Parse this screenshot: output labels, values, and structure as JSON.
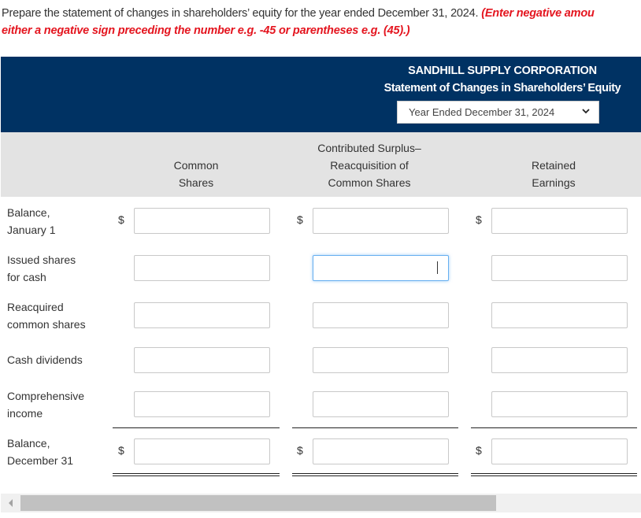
{
  "instructions": {
    "text": "Prepare the statement of changes in shareholders’ equity for the year ended December 31, 2024.",
    "note_line1": "(Enter negative amou",
    "note_line2": "either a negative sign preceding the number e.g. -45 or parentheses e.g. (45).)"
  },
  "header": {
    "company": "SANDHILL SUPPLY CORPORATION",
    "statement": "Statement of Changes in Shareholders’ Equity",
    "period_select": {
      "selected": "Year Ended December 31, 2024",
      "icon": "chevron-down-icon"
    }
  },
  "columns": [
    {
      "line1": "",
      "line2": "Common",
      "line3": "Shares"
    },
    {
      "line1": "Contributed Surplus–",
      "line2": "Reacquisition of",
      "line3": "Common Shares"
    },
    {
      "line1": "",
      "line2": "Retained",
      "line3": "Earnings"
    }
  ],
  "rows": [
    {
      "label1": "Balance,",
      "label2": "January 1",
      "dollar": "$",
      "values": [
        "",
        "",
        ""
      ]
    },
    {
      "label1": "Issued shares",
      "label2": "for cash",
      "dollar": "",
      "values": [
        "",
        "",
        ""
      ]
    },
    {
      "label1": "Reacquired",
      "label2": "common shares",
      "dollar": "",
      "values": [
        "",
        "",
        ""
      ]
    },
    {
      "label1": "Cash dividends",
      "label2": "",
      "dollar": "",
      "values": [
        "",
        "",
        ""
      ]
    },
    {
      "label1": "Comprehensive",
      "label2": "income",
      "dollar": "",
      "values": [
        "",
        "",
        ""
      ]
    },
    {
      "label1": "Balance,",
      "label2": "December 31",
      "dollar": "$",
      "values": [
        "",
        "",
        ""
      ]
    }
  ],
  "colors": {
    "header_bg": "#003263",
    "subheader_bg": "#e3e3e3",
    "note_red": "#e4151f",
    "focus_border": "#66aff0"
  },
  "scrollbar": {
    "icon": "scroll-left-arrow-icon"
  }
}
